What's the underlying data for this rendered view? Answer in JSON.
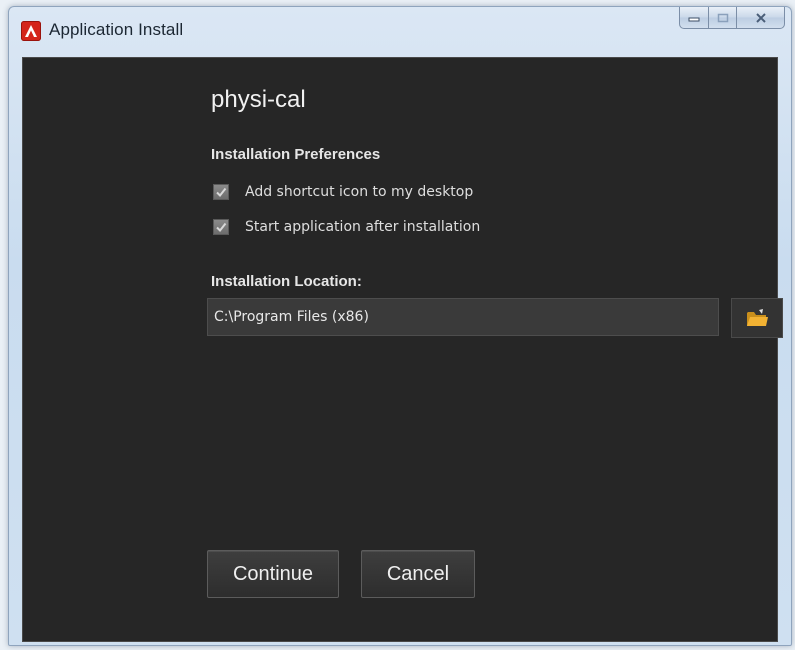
{
  "window": {
    "title": "Application Install"
  },
  "app": {
    "name": "physi-cal"
  },
  "preferences": {
    "heading": "Installation Preferences",
    "options": [
      {
        "label": "Add shortcut icon to my desktop",
        "checked": true
      },
      {
        "label": "Start application after installation",
        "checked": true
      }
    ]
  },
  "location": {
    "heading": "Installation Location:",
    "path": "C:\\Program Files (x86)",
    "browse_icon": "folder-icon"
  },
  "actions": {
    "continue_label": "Continue",
    "cancel_label": "Cancel"
  },
  "colors": {
    "panel_background": "#262626",
    "app_icon_red": "#d4241b",
    "folder_yellow": "#f2b233"
  },
  "icons": {
    "app": "adobe-air-icon",
    "minimize": "minimize-icon",
    "maximize": "maximize-icon",
    "close": "close-icon"
  }
}
